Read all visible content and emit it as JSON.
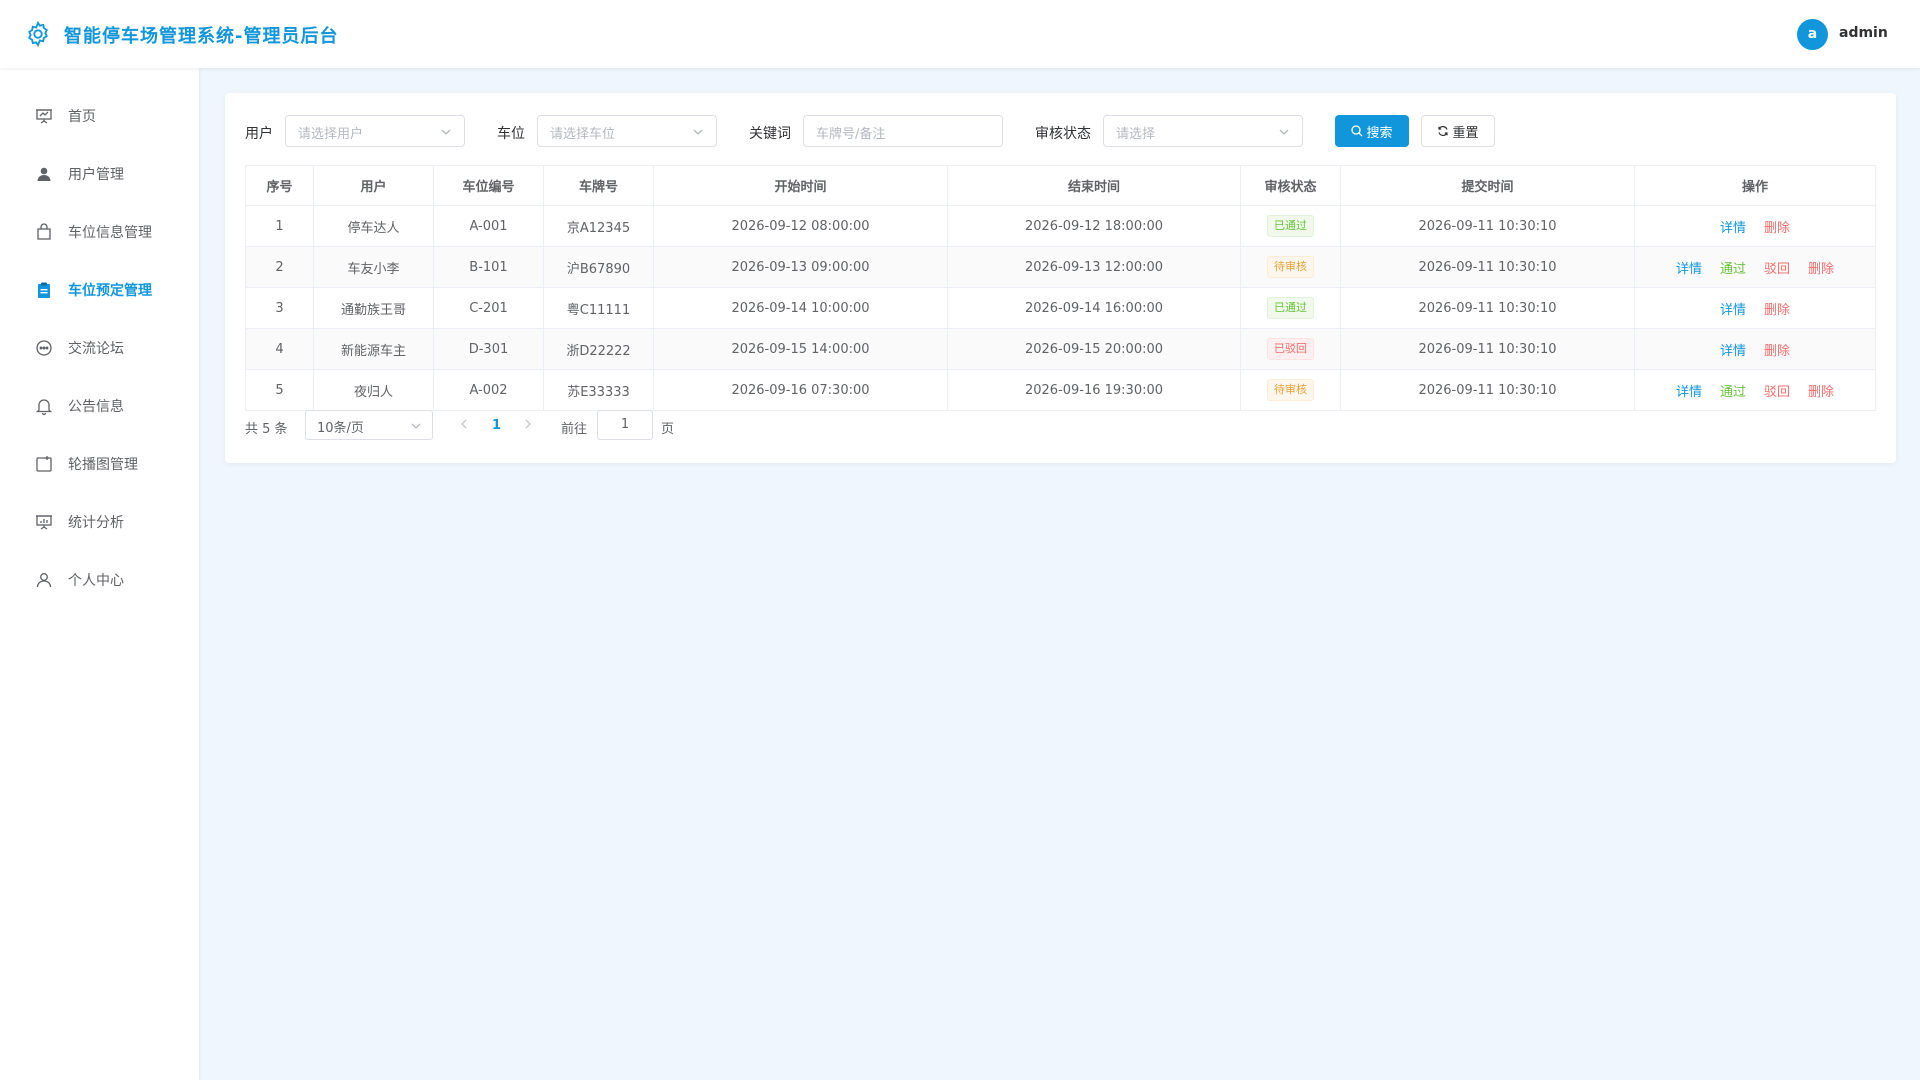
{
  "header": {
    "title": "智能停车场管理系统-管理员后台",
    "avatar_letter": "a",
    "username": "admin",
    "logo_icon": "gear-icon"
  },
  "sidebar": {
    "items": [
      {
        "label": "首页",
        "icon": "presentation-icon",
        "active": false
      },
      {
        "label": "用户管理",
        "icon": "user-icon",
        "active": false
      },
      {
        "label": "车位信息管理",
        "icon": "bag-icon",
        "active": false
      },
      {
        "label": "车位预定管理",
        "icon": "clipboard-icon",
        "active": true
      },
      {
        "label": "交流论坛",
        "icon": "chat-icon",
        "active": false
      },
      {
        "label": "公告信息",
        "icon": "bell-icon",
        "active": false
      },
      {
        "label": "轮播图管理",
        "icon": "image-icon",
        "active": false
      },
      {
        "label": "统计分析",
        "icon": "chart-board-icon",
        "active": false
      },
      {
        "label": "个人中心",
        "icon": "user-outline-icon",
        "active": false
      }
    ]
  },
  "filters": {
    "user": {
      "label": "用户",
      "placeholder": "请选择用户"
    },
    "slot": {
      "label": "车位",
      "placeholder": "请选择车位"
    },
    "keyword": {
      "label": "关键词",
      "placeholder": "车牌号/备注"
    },
    "status": {
      "label": "审核状态",
      "placeholder": "请选择"
    },
    "search_label": "搜索",
    "reset_label": "重置"
  },
  "table": {
    "headers": [
      "序号",
      "用户",
      "车位编号",
      "车牌号",
      "开始时间",
      "结束时间",
      "审核状态",
      "提交时间",
      "操作"
    ],
    "rows": [
      {
        "index": "1",
        "user": "停车达人",
        "slot": "A-001",
        "plate": "京A12345",
        "start": "2026-09-12 08:00:00",
        "end": "2026-09-12 18:00:00",
        "status": "已通过",
        "status_type": "green",
        "submitted": "2026-09-11 10:30:10",
        "actions": [
          "详情",
          "删除"
        ]
      },
      {
        "index": "2",
        "user": "车友小李",
        "slot": "B-101",
        "plate": "沪B67890",
        "start": "2026-09-13 09:00:00",
        "end": "2026-09-13 12:00:00",
        "status": "待审核",
        "status_type": "orange",
        "submitted": "2026-09-11 10:30:10",
        "actions": [
          "详情",
          "通过",
          "驳回",
          "删除"
        ]
      },
      {
        "index": "3",
        "user": "通勤族王哥",
        "slot": "C-201",
        "plate": "粤C11111",
        "start": "2026-09-14 10:00:00",
        "end": "2026-09-14 16:00:00",
        "status": "已通过",
        "status_type": "green",
        "submitted": "2026-09-11 10:30:10",
        "actions": [
          "详情",
          "删除"
        ]
      },
      {
        "index": "4",
        "user": "新能源车主",
        "slot": "D-301",
        "plate": "浙D22222",
        "start": "2026-09-15 14:00:00",
        "end": "2026-09-15 20:00:00",
        "status": "已驳回",
        "status_type": "red",
        "submitted": "2026-09-11 10:30:10",
        "actions": [
          "详情",
          "删除"
        ]
      },
      {
        "index": "5",
        "user": "夜归人",
        "slot": "A-002",
        "plate": "苏E33333",
        "start": "2026-09-16 07:30:00",
        "end": "2026-09-16 19:30:00",
        "status": "待审核",
        "status_type": "orange",
        "submitted": "2026-09-11 10:30:10",
        "actions": [
          "详情",
          "通过",
          "驳回",
          "删除"
        ]
      }
    ],
    "action_colors": {
      "详情": "blue",
      "通过": "green",
      "驳回": "red",
      "删除": "red"
    }
  },
  "pagination": {
    "total_text": "共 5 条",
    "page_size": "10条/页",
    "current_page": "1",
    "goto_label": "前往",
    "goto_value": "1",
    "page_suffix": "页"
  },
  "colors": {
    "accent": "#1296db",
    "success": "#67c23a",
    "warning": "#e6a23c",
    "danger": "#f56c6c",
    "background": "#f0f6fd"
  }
}
